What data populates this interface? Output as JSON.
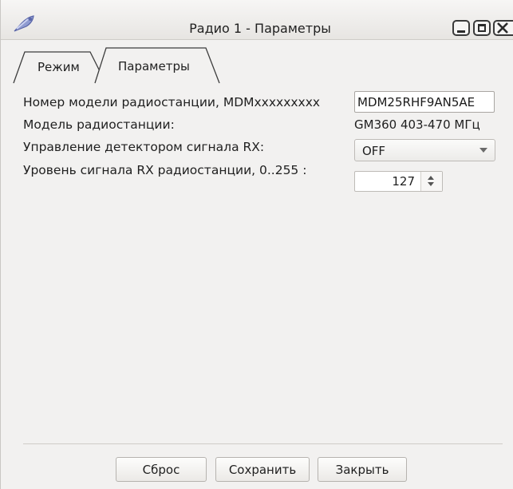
{
  "window": {
    "title": "Радио 1 - Параметры",
    "app_icon": "satellite-icon"
  },
  "tabs": [
    {
      "label": "Режим",
      "active": false
    },
    {
      "label": "Параметры",
      "active": true
    }
  ],
  "form": {
    "model_number": {
      "label": "Номер модели радиостанции, MDMxxxxxxxxx",
      "value": "MDM25RHF9AN5AE"
    },
    "radio_model": {
      "label": "Модель радиостанции:",
      "value": "GM360 403-470 МГц"
    },
    "rx_detector": {
      "label": "Управление детектором сигнала RX:",
      "value": "OFF"
    },
    "rx_level": {
      "label": "Уровень сигнала RX радиостанции, 0..255 :",
      "value": "127"
    }
  },
  "buttons": {
    "reset": "Сброс",
    "save": "Сохранить",
    "close": "Закрыть"
  }
}
